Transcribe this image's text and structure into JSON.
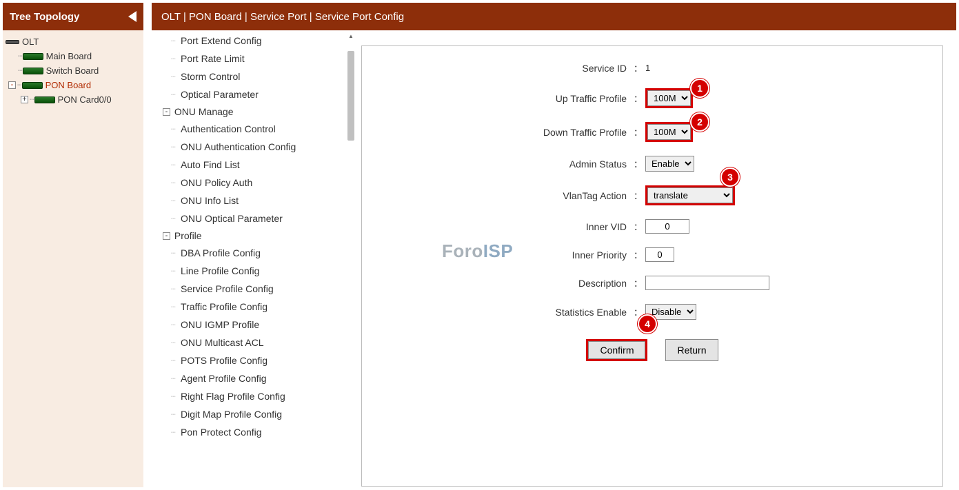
{
  "sidebar": {
    "title": "Tree Topology",
    "items": [
      {
        "label": "OLT",
        "depth": 0,
        "icon": "small",
        "expander": ""
      },
      {
        "label": "Main Board",
        "depth": 1,
        "icon": "chip",
        "expander": ""
      },
      {
        "label": "Switch Board",
        "depth": 1,
        "icon": "chip",
        "expander": ""
      },
      {
        "label": "PON Board",
        "depth": 1,
        "icon": "chip",
        "expander": "-",
        "active": true
      },
      {
        "label": "PON Card0/0",
        "depth": 2,
        "icon": "chip",
        "expander": "+"
      }
    ]
  },
  "breadcrumb": "OLT | PON Board | Service Port | Service Port Config",
  "midnav": {
    "top_items": [
      "Port Extend Config",
      "Port Rate Limit",
      "Storm Control",
      "Optical Parameter"
    ],
    "groups": [
      {
        "label": "ONU Manage",
        "items": [
          "Authentication Control",
          "ONU Authentication Config",
          "Auto Find List",
          "ONU Policy Auth",
          "ONU Info List",
          "ONU Optical Parameter"
        ]
      },
      {
        "label": "Profile",
        "items": [
          "DBA Profile Config",
          "Line Profile Config",
          "Service Profile Config",
          "Traffic Profile Config",
          "ONU IGMP Profile",
          "ONU Multicast ACL",
          "POTS Profile Config",
          "Agent Profile Config",
          "Right Flag Profile Config",
          "Digit Map Profile Config",
          "Pon Protect Config"
        ]
      }
    ]
  },
  "form": {
    "service_id_label": "Service ID",
    "service_id_value": "1",
    "up_traffic_label": "Up Traffic Profile",
    "up_traffic_value": "100M",
    "down_traffic_label": "Down Traffic Profile",
    "down_traffic_value": "100M",
    "admin_status_label": "Admin Status",
    "admin_status_value": "Enable",
    "vlan_action_label": "VlanTag Action",
    "vlan_action_value": "translate",
    "inner_vid_label": "Inner VID",
    "inner_vid_value": "0",
    "inner_priority_label": "Inner Priority",
    "inner_priority_value": "0",
    "description_label": "Description",
    "description_value": "",
    "stats_enable_label": "Statistics Enable",
    "stats_enable_value": "Disable",
    "confirm": "Confirm",
    "return": "Return"
  },
  "callouts": {
    "c1": "1",
    "c2": "2",
    "c3": "3",
    "c4": "4"
  },
  "watermark": {
    "a": "Foro",
    "b": "ISP"
  }
}
